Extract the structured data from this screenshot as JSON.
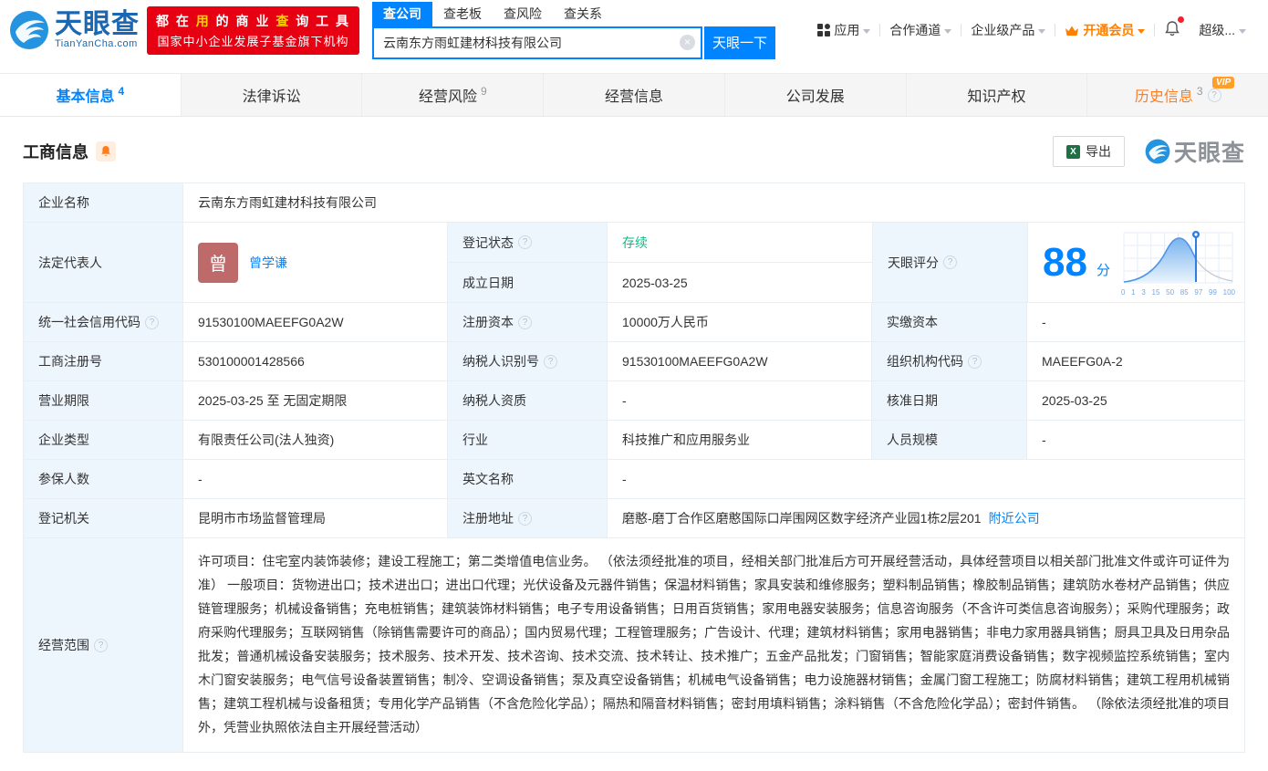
{
  "header": {
    "logo": {
      "title": "天眼查",
      "subtitle": "TianYanCha.com"
    },
    "promo": {
      "l1a": "都 在 ",
      "l1b": "用",
      "l1c": " 的 商 业 ",
      "l1d": "查",
      "l1e": " 询 工 具",
      "line2": "国家中小企业发展子基金旗下机构"
    },
    "search": {
      "tabs": [
        {
          "label": "查公司"
        },
        {
          "label": "查老板"
        },
        {
          "label": "查风险"
        },
        {
          "label": "查关系"
        }
      ],
      "value": "云南东方雨虹建材科技有限公司",
      "button": "天眼一下"
    },
    "nav": [
      {
        "label": "应用"
      },
      {
        "label": "合作通道"
      },
      {
        "label": "企业级产品"
      },
      {
        "label": "开通会员"
      },
      {
        "label": "超级..."
      }
    ]
  },
  "tabs": [
    {
      "label": "基本信息",
      "count": "4"
    },
    {
      "label": "法律诉讼",
      "count": ""
    },
    {
      "label": "经营风险",
      "count": "9"
    },
    {
      "label": "经营信息",
      "count": ""
    },
    {
      "label": "公司发展",
      "count": ""
    },
    {
      "label": "知识产权",
      "count": ""
    },
    {
      "label": "历史信息",
      "count": "3",
      "vip": "VIP"
    }
  ],
  "section": {
    "title": "工商信息",
    "export_label": "导出",
    "watermark": "天眼查"
  },
  "table": {
    "name_label": "企业名称",
    "name": "云南东方雨虹建材科技有限公司",
    "legal_rep_label": "法定代表人",
    "legal_rep_avatar": "曾",
    "legal_rep_name": "曾学谦",
    "reg_status_label": "登记状态",
    "reg_status": "存续",
    "establish_label": "成立日期",
    "establish_date": "2025-03-25",
    "score_label": "天眼评分",
    "score": "88",
    "score_unit": "分",
    "score_axis": [
      "0",
      "1",
      "3",
      "15",
      "50",
      "85",
      "97",
      "99",
      "100"
    ],
    "uscc_label": "统一社会信用代码",
    "uscc": "91530100MAEEFG0A2W",
    "reg_capital_label": "注册资本",
    "reg_capital": "10000万人民币",
    "paid_capital_label": "实缴资本",
    "paid_capital": "-",
    "reg_no_label": "工商注册号",
    "reg_no": "530100001428566",
    "taxpayer_id_label": "纳税人识别号",
    "taxpayer_id": "91530100MAEEFG0A2W",
    "org_code_label": "组织机构代码",
    "org_code": "MAEEFG0A-2",
    "biz_term_label": "营业期限",
    "biz_term": "2025-03-25 至 无固定期限",
    "taxpayer_qual_label": "纳税人资质",
    "taxpayer_qual": "-",
    "approval_date_label": "核准日期",
    "approval_date": "2025-03-25",
    "company_type_label": "企业类型",
    "company_type": "有限责任公司(法人独资)",
    "industry_label": "行业",
    "industry": "科技推广和应用服务业",
    "staff_size_label": "人员规模",
    "staff_size": "-",
    "insured_label": "参保人数",
    "insured": "-",
    "english_name_label": "英文名称",
    "english_name": "-",
    "reg_authority_label": "登记机关",
    "reg_authority": "昆明市市场监督管理局",
    "reg_address_label": "注册地址",
    "reg_address": "磨憨-磨丁合作区磨憨国际口岸围网区数字经济产业园1栋2层201",
    "nearby_link": "附近公司",
    "biz_scope_label": "经营范围",
    "biz_scope": "许可项目：住宅室内装饰装修；建设工程施工；第二类增值电信业务。 （依法须经批准的项目，经相关部门批准后方可开展经营活动，具体经营项目以相关部门批准文件或许可证件为准） 一般项目：货物进出口；技术进出口；进出口代理；光伏设备及元器件销售；保温材料销售；家具安装和维修服务；塑料制品销售；橡胶制品销售；建筑防水卷材产品销售；供应链管理服务；机械设备销售；充电桩销售；建筑装饰材料销售；电子专用设备销售；日用百货销售；家用电器安装服务；信息咨询服务（不含许可类信息咨询服务）；采购代理服务；政府采购代理服务；互联网销售（除销售需要许可的商品）；国内贸易代理；工程管理服务；广告设计、代理；建筑材料销售；家用电器销售；非电力家用器具销售；厨具卫具及日用杂品批发；普通机械设备安装服务；技术服务、技术开发、技术咨询、技术交流、技术转让、技术推广；五金产品批发；门窗销售；智能家庭消费设备销售；数字视频监控系统销售；室内木门窗安装服务；电气信号设备装置销售；制冷、空调设备销售；泵及真空设备销售；机械电气设备销售；电力设施器材销售；金属门窗工程施工；防腐材料销售；建筑工程用机械销售；建筑工程机械与设备租赁；专用化学产品销售（不含危险化学品）；隔热和隔音材料销售；密封用填料销售；涂料销售（不含危险化学品）；密封件销售。 （除依法须经批准的项目外，凭营业执照依法自主开展经营活动）"
  },
  "colors": {
    "accent": "#0084ff",
    "status_green": "#0bbd87",
    "vip_orange": "#ff8000",
    "promo_red": "#e60012"
  }
}
